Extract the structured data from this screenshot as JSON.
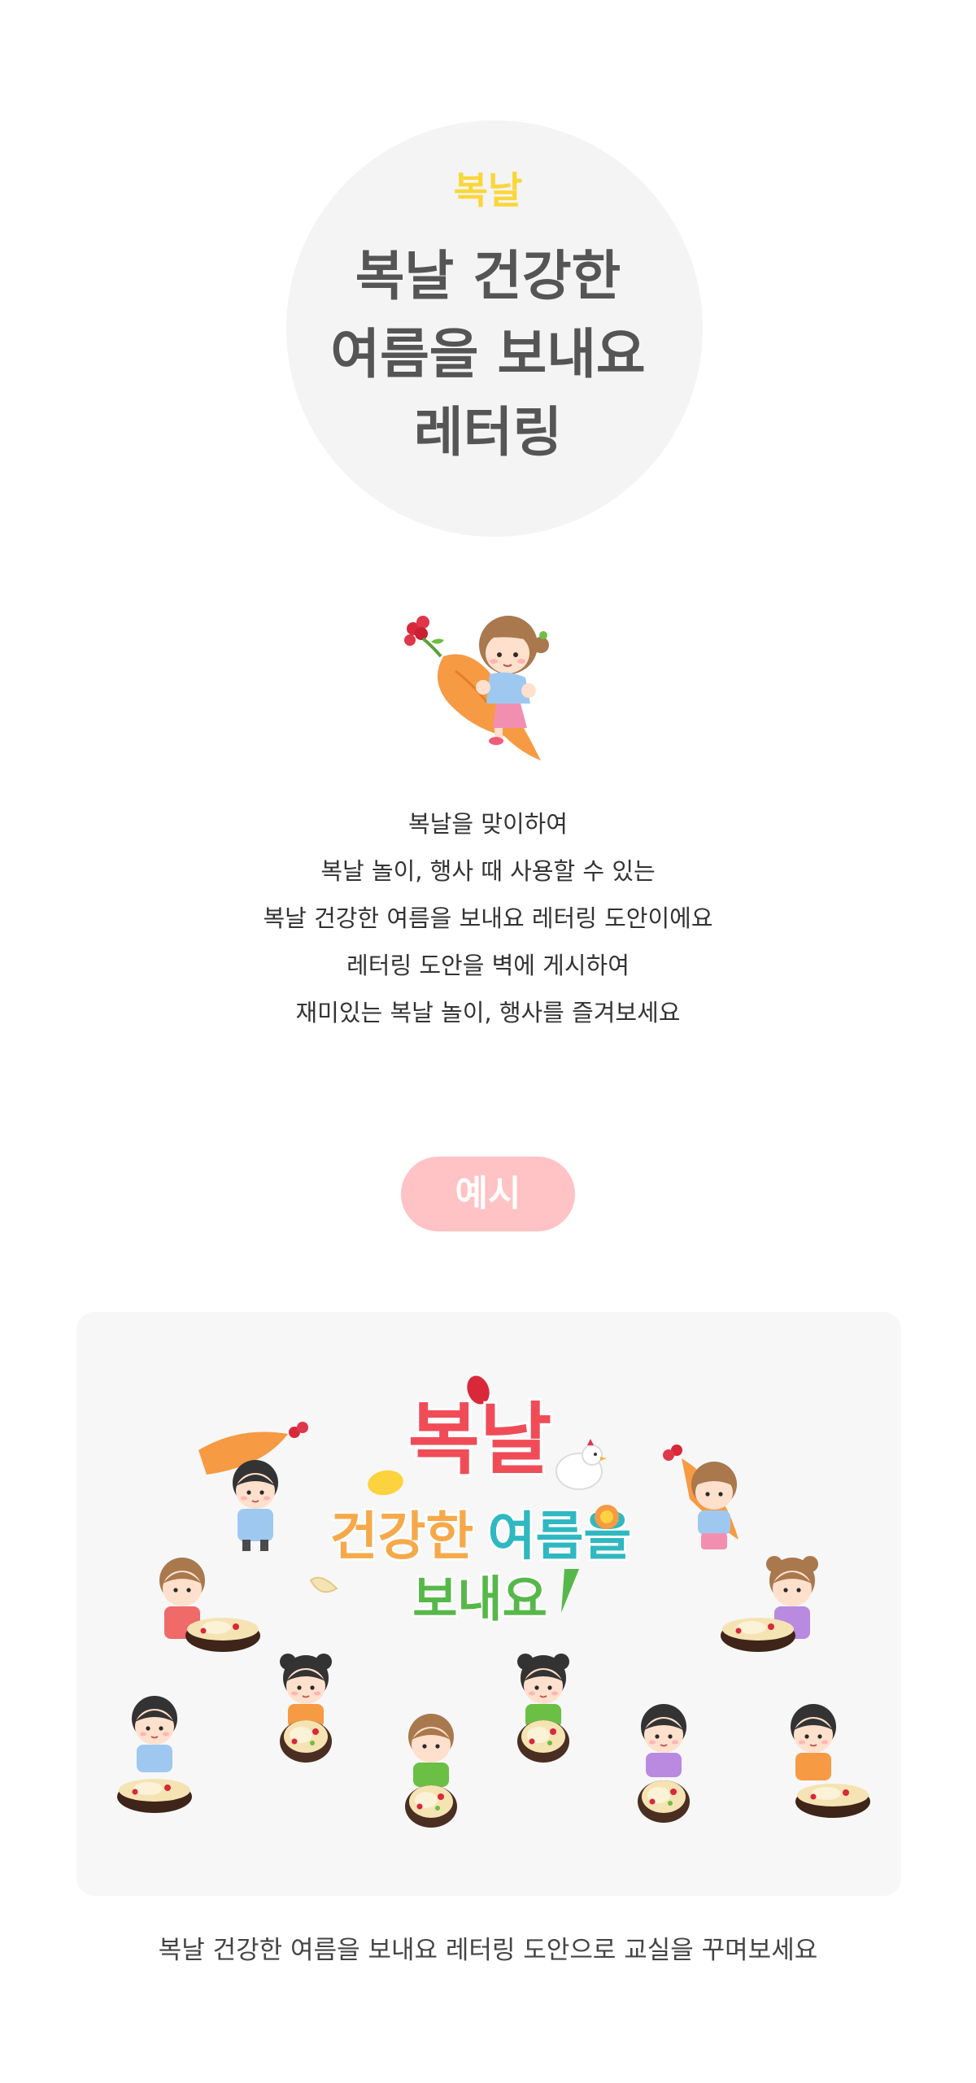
{
  "hero": {
    "tag": "복날",
    "title_lines": [
      "복날 건강한",
      "여름을 보내요",
      "레터링"
    ]
  },
  "intro": {
    "lines": [
      "복날을 맞이하여",
      "복날 놀이, 행사 때 사용할 수 있는",
      "복날 건강한 여름을 보내요 레터링 도안이에요",
      "레터링 도안을 벽에 게시하여",
      "재미있는 복날 놀이, 행사를 즐겨보세요"
    ]
  },
  "example": {
    "badge": "예시",
    "lettering": {
      "word1": "복날",
      "word2": "건강한",
      "word3": "여름을",
      "word4": "보내요"
    },
    "colors": {
      "word1": "#f04c58",
      "word2": "#f6a94a",
      "word3": "#2fb8c1",
      "word4": "#56b84a"
    }
  },
  "caption": "복날 건강한 여름을 보내요 레터링 도안으로 교실을 꾸며보세요",
  "colors": {
    "hero_tag": "#fbd63a",
    "hero_title": "#555555",
    "badge_bg": "#ffc3c5",
    "panel_bg": "#f7f7f7"
  }
}
